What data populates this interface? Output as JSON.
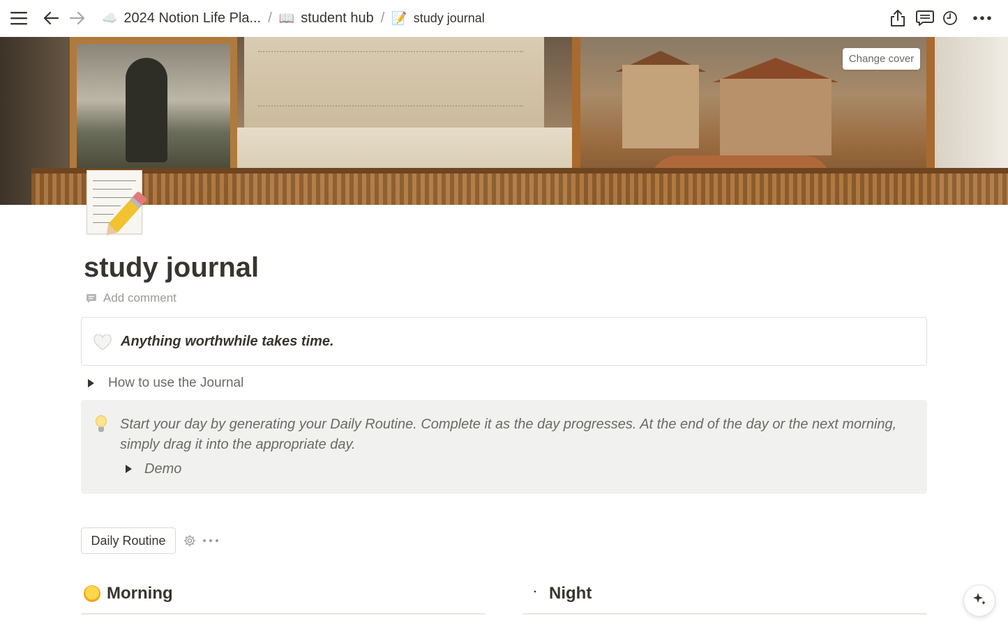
{
  "topbar": {
    "breadcrumbs": [
      {
        "emoji": "☁️",
        "label": "2024 Notion Life Pla..."
      },
      {
        "emoji": "📖",
        "label": "student hub"
      },
      {
        "emoji": "📝",
        "label": "study journal"
      }
    ],
    "separator": "/"
  },
  "cover": {
    "change_cover_label": "Change cover"
  },
  "page": {
    "title": "study journal",
    "add_comment": "Add comment"
  },
  "quote_callout": {
    "text": "Anything worthwhile takes time."
  },
  "toggle": {
    "label": "How to use the Journal"
  },
  "info_callout": {
    "text": "Start your day by generating your Daily Routine. Complete it as the day progresses. At the end of the day or the next morning, simply drag it into the appropriate day.",
    "demo_label": "Demo"
  },
  "routine_button": {
    "label": "Daily Routine"
  },
  "sections": [
    {
      "label": "Morning"
    },
    {
      "label": "Night"
    }
  ]
}
